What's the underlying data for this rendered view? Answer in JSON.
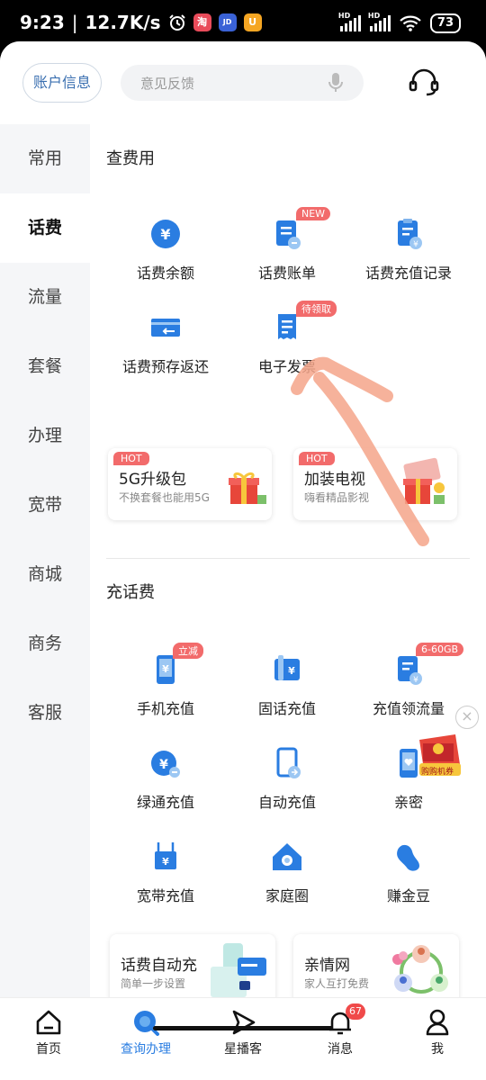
{
  "status_bar": {
    "time": "9:23",
    "speed": "12.7K/s",
    "battery": "73",
    "hd1": "HD",
    "hd2": "HD"
  },
  "header": {
    "account_button": "账户信息",
    "search_placeholder": "意见反馈"
  },
  "sidebar": {
    "items": [
      {
        "label": "常用"
      },
      {
        "label": "话费"
      },
      {
        "label": "流量"
      },
      {
        "label": "套餐"
      },
      {
        "label": "办理"
      },
      {
        "label": "宽带"
      },
      {
        "label": "商城"
      },
      {
        "label": "商务"
      },
      {
        "label": "客服"
      }
    ],
    "active_index": 1
  },
  "section_query": {
    "title": "查费用",
    "items": [
      {
        "label": "话费余额",
        "icon": "yuan-coin-icon"
      },
      {
        "label": "话费账单",
        "icon": "bill-icon",
        "tag": "NEW"
      },
      {
        "label": "话费充值记录",
        "icon": "recharge-record-icon"
      },
      {
        "label": "话费预存返还",
        "icon": "card-return-icon"
      },
      {
        "label": "电子发票",
        "icon": "invoice-icon",
        "tag": "待领取"
      }
    ],
    "cards": [
      {
        "hot": "HOT",
        "title": "5G升级包",
        "subtitle": "不换套餐也能用5G"
      },
      {
        "hot": "HOT",
        "title": "加装电视",
        "subtitle": "嗨看精品影视"
      }
    ]
  },
  "section_recharge": {
    "title": "充话费",
    "items": [
      {
        "label": "手机充值",
        "icon": "phone-recharge-icon",
        "tag": "立减"
      },
      {
        "label": "固话充值",
        "icon": "landline-recharge-icon"
      },
      {
        "label": "充值领流量",
        "icon": "flow-recharge-icon",
        "tag": "6-60GB"
      },
      {
        "label": "绿通充值",
        "icon": "green-recharge-icon"
      },
      {
        "label": "自动充值",
        "icon": "auto-recharge-icon"
      },
      {
        "label": "亲密 ",
        "icon": "intimate-pay-icon"
      },
      {
        "label": "宽带充值",
        "icon": "broadband-recharge-icon"
      },
      {
        "label": "家庭圈",
        "icon": "family-circle-icon"
      },
      {
        "label": "赚金豆",
        "icon": "gold-bean-icon"
      }
    ],
    "cards": [
      {
        "title": "话费自动充",
        "subtitle": "简单一步设置"
      },
      {
        "title": "亲情网",
        "subtitle": "家人互打免费"
      }
    ]
  },
  "float": {
    "close": "×",
    "promo_label": "购购机券"
  },
  "bottom_nav": {
    "items": [
      {
        "label": "首页",
        "icon": "home-icon"
      },
      {
        "label": "查询办理",
        "icon": "query-icon"
      },
      {
        "label": "星播客",
        "icon": "play-icon"
      },
      {
        "label": "消息",
        "icon": "bell-icon",
        "badge": "67"
      },
      {
        "label": "我",
        "icon": "user-icon"
      }
    ],
    "active_index": 1
  },
  "colors": {
    "accent_blue": "#2a7de1",
    "tag_red": "#f26b6b",
    "annotation_stroke": "#f4a48a"
  }
}
